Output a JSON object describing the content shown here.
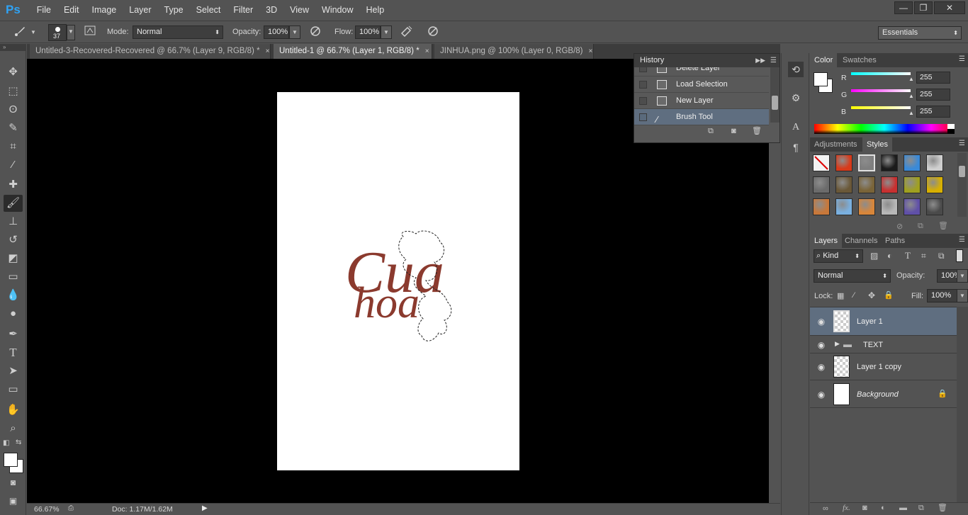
{
  "app": {
    "logo": "Ps",
    "menu": [
      "File",
      "Edit",
      "Image",
      "Layer",
      "Type",
      "Select",
      "Filter",
      "3D",
      "View",
      "Window",
      "Help"
    ],
    "window_controls": {
      "minimize": "—",
      "restore": "❐",
      "close": "✕"
    }
  },
  "options": {
    "brush_size": "37",
    "mode_label": "Mode:",
    "mode_value": "Normal",
    "opacity_label": "Opacity:",
    "opacity_value": "100%",
    "flow_label": "Flow:",
    "flow_value": "100%",
    "workspace": "Essentials"
  },
  "documents": {
    "tabs": [
      {
        "label": "Untitled-3-Recovered-Recovered @ 66.7% (Layer 9, RGB/8) *",
        "close": "×",
        "active": false
      },
      {
        "label": "Untitled-1 @ 66.7% (Layer 1, RGB/8) *",
        "close": "×",
        "active": true
      },
      {
        "label": "JINHUA.png @ 100% (Layer 0, RGB/8)",
        "close": "×",
        "active": false
      }
    ]
  },
  "canvas": {
    "text_line1": "Cua",
    "text_line2": "hoa",
    "text_color": "#8b3a2e",
    "page_color": "#ffffff"
  },
  "status": {
    "zoom": "66.67%",
    "doc": "Doc: 1.17M/1.62M"
  },
  "history": {
    "title": "History",
    "items": [
      {
        "label": "Delete Layer",
        "selected": false
      },
      {
        "label": "Load Selection",
        "selected": false
      },
      {
        "label": "New Layer",
        "selected": false
      },
      {
        "label": "Brush Tool",
        "selected": true
      }
    ]
  },
  "color_panel": {
    "tabs": [
      "Color",
      "Swatches"
    ],
    "r_label": "R",
    "r_value": "255",
    "g_label": "G",
    "g_value": "255",
    "b_label": "B",
    "b_value": "255"
  },
  "styles_panel": {
    "tabs": [
      "Adjustments",
      "Styles"
    ],
    "swatch_colors": [
      "#f3f3f3",
      "#d83a1a",
      "#7f7f7f",
      "#1b1b1b",
      "#3a8ad8",
      "#cfcfcf",
      "#6b6b6b",
      "#6a5838",
      "#7a6438",
      "#c83030",
      "#a0a020",
      "#d8b000",
      "#c8783a",
      "#7ab0e0",
      "#d8863a",
      "#b8b8b8",
      "#6050a8",
      "#4a4a4a"
    ]
  },
  "layers_panel": {
    "tabs": [
      "Layers",
      "Channels",
      "Paths"
    ],
    "filter_kind": "Kind",
    "blend_mode": "Normal",
    "opacity_label": "Opacity:",
    "opacity_value": "100%",
    "lock_label": "Lock:",
    "fill_label": "Fill:",
    "fill_value": "100%",
    "layers": [
      {
        "name": "Layer 1",
        "selected": true
      },
      {
        "name": "TEXT",
        "selected": false
      },
      {
        "name": "Layer 1 copy",
        "selected": false
      },
      {
        "name": "Background",
        "selected": false
      }
    ],
    "footer_fx": "fx."
  }
}
